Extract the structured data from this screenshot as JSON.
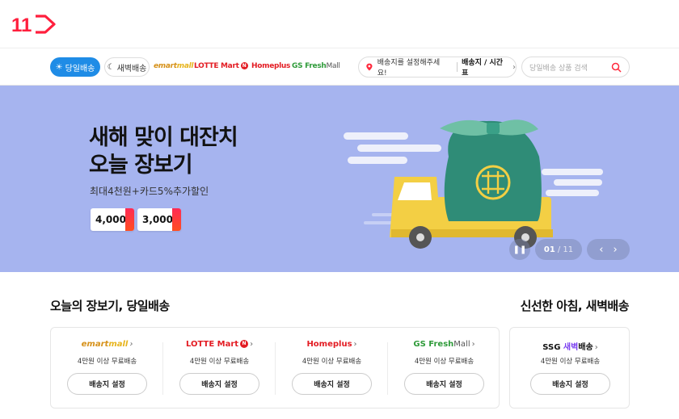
{
  "header": {
    "logo_text": "11"
  },
  "nav": {
    "tabs": [
      {
        "label": "당일배송",
        "icon": "sun-icon",
        "active": true
      },
      {
        "label": "새벽배송",
        "icon": "moon-icon",
        "active": false
      }
    ],
    "brands": [
      {
        "name": "emart",
        "suffix": "mall"
      },
      {
        "name": "LOTTE Mart",
        "badge": "N"
      },
      {
        "name": "Homeplus"
      },
      {
        "name": "GS Fresh",
        "suffix": "Mall"
      }
    ],
    "address": {
      "text": "배송지를 설정해주세요!",
      "link": "배송지 / 시간표",
      "chevron": "›"
    },
    "search": {
      "placeholder": "당일배송 상품 검색"
    }
  },
  "banner": {
    "title_line1": "새해 맞이 대잔치",
    "title_line2": "오늘 장보기",
    "subtitle": "최대4천원+카드5%추가할인",
    "coupons": [
      "4,000",
      "3,000"
    ],
    "page_current": "01",
    "page_total": "/ 11",
    "colors": {
      "background": "#a6b4ef"
    }
  },
  "sections": {
    "same_day_title": "오늘의 장보기, 당일배송",
    "dawn_title": "신선한 아침, 새벽배송"
  },
  "stores": [
    {
      "name": "emart",
      "suffix": "mall",
      "arrow": "›",
      "condition": "4만원 이상 무료배송",
      "button": "배송지 설정"
    },
    {
      "name": "LOTTE Mart",
      "badge": "N",
      "arrow": "›",
      "condition": "4만원 이상 무료배송",
      "button": "배송지 설정"
    },
    {
      "name": "Homeplus",
      "arrow": "›",
      "condition": "4만원 이상 무료배송",
      "button": "배송지 설정"
    },
    {
      "name": "GS Fresh",
      "suffix": "Mall",
      "arrow": "›",
      "condition": "4만원 이상 무료배송",
      "button": "배송지 설정"
    }
  ],
  "dawn_store": {
    "name": "SSG",
    "dawn": "새벽",
    "tail": "배송",
    "arrow": "›",
    "condition": "4만원 이상 무료배송",
    "button": "배송지 설정"
  }
}
